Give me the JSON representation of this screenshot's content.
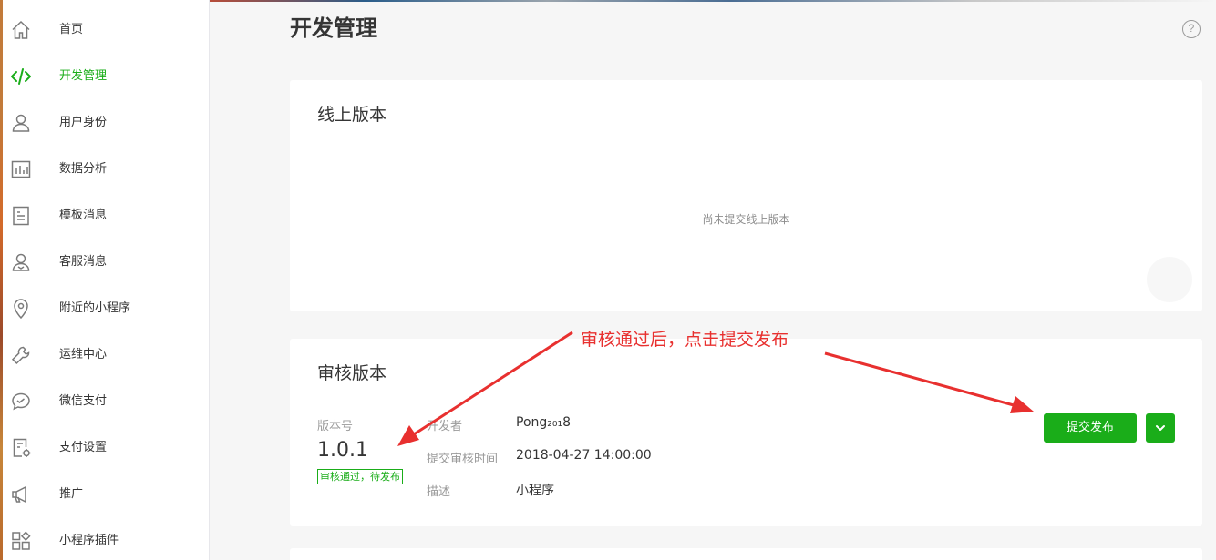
{
  "page_title": "开发管理",
  "help_symbol": "?",
  "sidebar": {
    "items": [
      {
        "label": "首页",
        "icon": "home-icon"
      },
      {
        "label": "开发管理",
        "icon": "code-icon",
        "active": true
      },
      {
        "label": "用户身份",
        "icon": "user-icon"
      },
      {
        "label": "数据分析",
        "icon": "bar-chart-icon"
      },
      {
        "label": "模板消息",
        "icon": "document-icon"
      },
      {
        "label": "客服消息",
        "icon": "customer-service-icon"
      },
      {
        "label": "附近的小程序",
        "icon": "location-pin-icon"
      },
      {
        "label": "运维中心",
        "icon": "wrench-icon"
      },
      {
        "label": "微信支付",
        "icon": "wechat-pay-icon"
      },
      {
        "label": "支付设置",
        "icon": "payment-settings-icon"
      },
      {
        "label": "推广",
        "icon": "megaphone-icon"
      },
      {
        "label": "小程序插件",
        "icon": "plugin-icon"
      }
    ]
  },
  "online_version": {
    "title": "线上版本",
    "empty_text": "尚未提交线上版本"
  },
  "review_version": {
    "title": "审核版本",
    "version_label": "版本号",
    "version": "1.0.1",
    "status": "审核通过，待发布",
    "developer_label": "开发者",
    "developer": "Pong₂₀₁8",
    "submit_time_label": "提交审核时间",
    "submit_time": "2018-04-27 14:00:00",
    "description_label": "描述",
    "description": "小程序",
    "submit_button": "提交发布"
  },
  "annotation": {
    "text": "审核通过后，点击提交发布",
    "color": "#e8302f"
  },
  "colors": {
    "accent": "#1aad19",
    "text": "#353535",
    "muted": "#9a9a9a"
  }
}
